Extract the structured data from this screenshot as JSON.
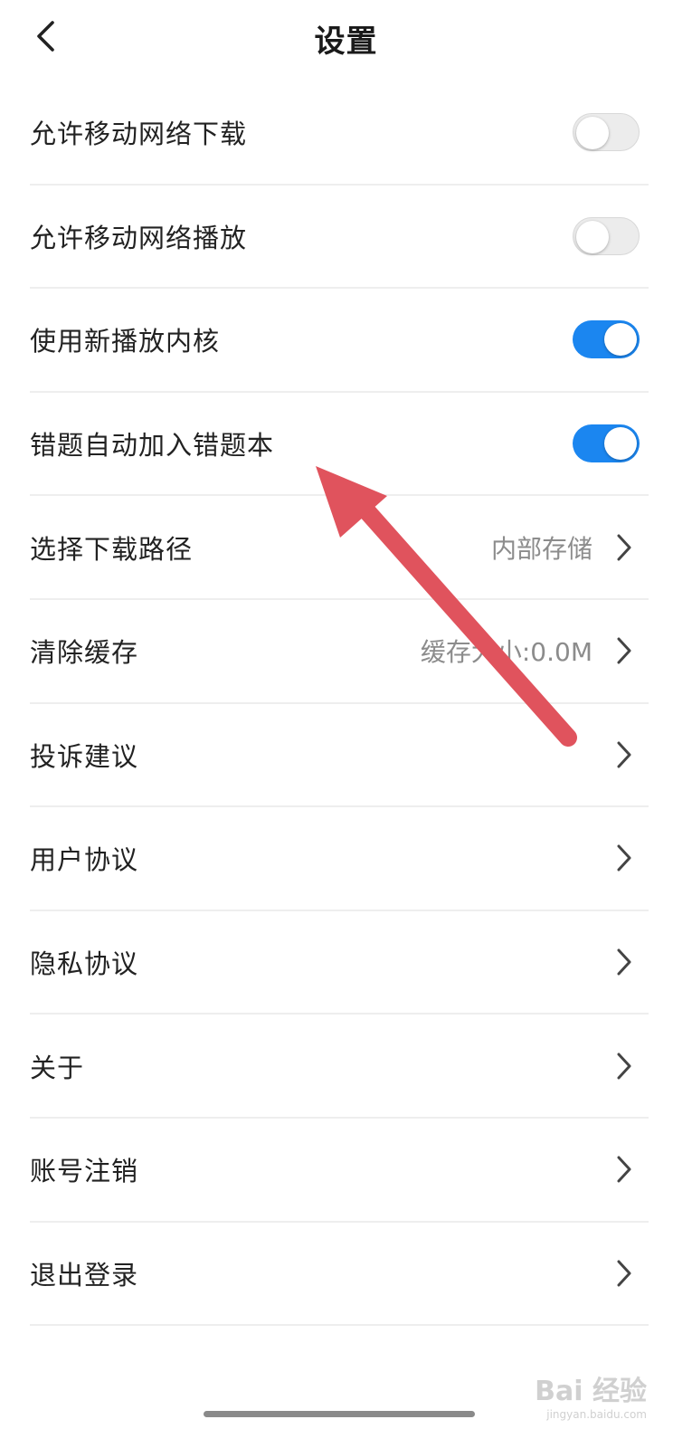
{
  "header": {
    "title": "设置"
  },
  "settings": [
    {
      "label": "允许移动网络下载",
      "type": "toggle",
      "on": false
    },
    {
      "label": "允许移动网络播放",
      "type": "toggle",
      "on": false
    },
    {
      "label": "使用新播放内核",
      "type": "toggle",
      "on": true
    },
    {
      "label": "错题自动加入错题本",
      "type": "toggle",
      "on": true
    },
    {
      "label": "选择下载路径",
      "type": "nav",
      "value": "内部存储"
    },
    {
      "label": "清除缓存",
      "type": "nav",
      "value": "缓存大小:0.0M"
    },
    {
      "label": "投诉建议",
      "type": "nav",
      "value": ""
    },
    {
      "label": "用户协议",
      "type": "nav",
      "value": ""
    },
    {
      "label": "隐私协议",
      "type": "nav",
      "value": ""
    },
    {
      "label": "关于",
      "type": "nav",
      "value": ""
    },
    {
      "label": "账号注销",
      "type": "nav",
      "value": ""
    },
    {
      "label": "退出登录",
      "type": "nav",
      "value": ""
    }
  ],
  "colors": {
    "switch_on": "#1b86f0",
    "switch_off": "#ececec",
    "annotation_arrow": "#e0535d"
  },
  "icons": {
    "back": "chevron-left-icon",
    "row_nav": "chevron-right-icon"
  },
  "watermark": {
    "main": "Bai 经验",
    "sub": "jingyan.baidu.com"
  }
}
